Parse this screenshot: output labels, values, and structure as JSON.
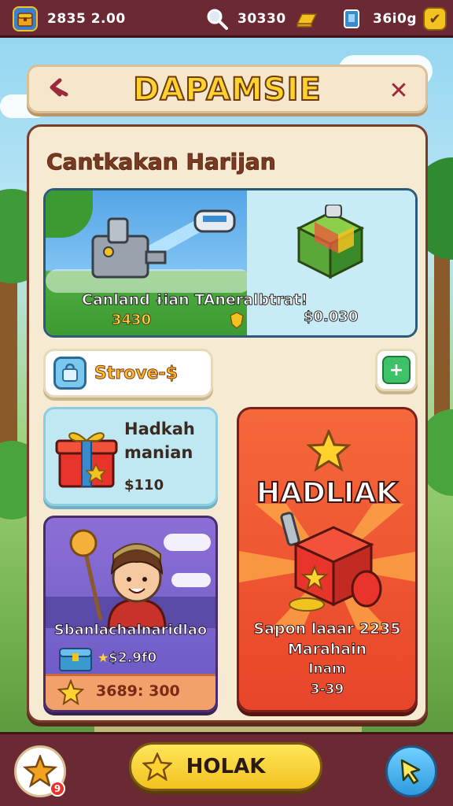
{
  "topbar": {
    "coins_value": "2835 2.00",
    "search_value": "30330",
    "gems_value": "36i0g"
  },
  "header": {
    "title": "DAPAMSIE"
  },
  "panel": {
    "section_title": "Cantkakan Harijan",
    "banner": {
      "caption": "Canland ɨian TAneralbtrat!",
      "price_left": "3430",
      "price_right": "$0.030"
    },
    "store_chip_label": "Strove-$",
    "gift_card": {
      "title_line1": "Hadkah",
      "title_line2": "manian",
      "price": "$110"
    },
    "big_card": {
      "title": "HADLIAK",
      "desc_line1": "Sapon laaar 2235",
      "desc_line2": "Marahain",
      "desc_line3": "Inam",
      "desc_line4": "3-39"
    },
    "char_card": {
      "name": "Sbanlachalnaridlao",
      "price": "$2.9f0",
      "footer_value": "3689: 300"
    }
  },
  "bottombar": {
    "main_button_label": "HOLAK",
    "notif_count": "9"
  },
  "colors": {
    "bar_bg": "#6b2a33",
    "title_yellow": "#ffd22e",
    "big_card_orange": "#f5683a"
  }
}
